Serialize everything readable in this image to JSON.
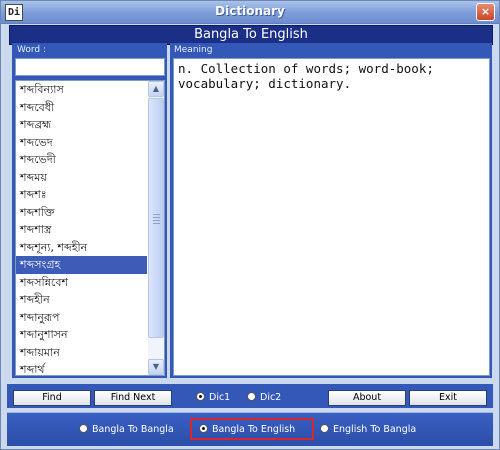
{
  "window": {
    "title": "Dictionary",
    "icon_label": "Di",
    "close_label": "×"
  },
  "header": {
    "title": "Bangla To English"
  },
  "labels": {
    "word": "Word :",
    "meaning": "Meaning"
  },
  "search": {
    "value": "",
    "placeholder": ""
  },
  "word_list": {
    "items": [
      "শব্দবিন্যাস",
      "শব্দবেধী",
      "শব্দব্রহ্ম",
      "শব্দভেদ",
      "শব্দভেদী",
      "শব্দময়",
      "শব্দশঃ",
      "শব্দশক্তি",
      "শব্দশাস্ত্র",
      "শব্দশূন্য, শব্দহীন",
      "শব্দসংগ্রহ",
      "শব্দসন্নিবেশ",
      "শব্দহীন",
      "শব্দানুরূপ",
      "শব্দানুশাসন",
      "শব্দায়মান",
      "শব্দার্থ"
    ],
    "selected_index": 10
  },
  "meaning": {
    "text": "n. Collection of words; word-book; vocabulary; dictionary."
  },
  "buttons": {
    "find": "Find",
    "find_next": "Find Next",
    "about": "About",
    "exit": "Exit"
  },
  "dictionary_source": {
    "options": [
      "Dic1",
      "Dic2"
    ],
    "selected": "Dic1"
  },
  "modes": {
    "options": [
      "Bangla To Bangla",
      "Bangla To English",
      "English To Bangla"
    ],
    "selected": "Bangla To English"
  },
  "colors": {
    "header_bg": "#1b2f86",
    "panel_bg": "#3458b8",
    "highlight": "#d8262a",
    "selection": "#3d5cb8"
  }
}
